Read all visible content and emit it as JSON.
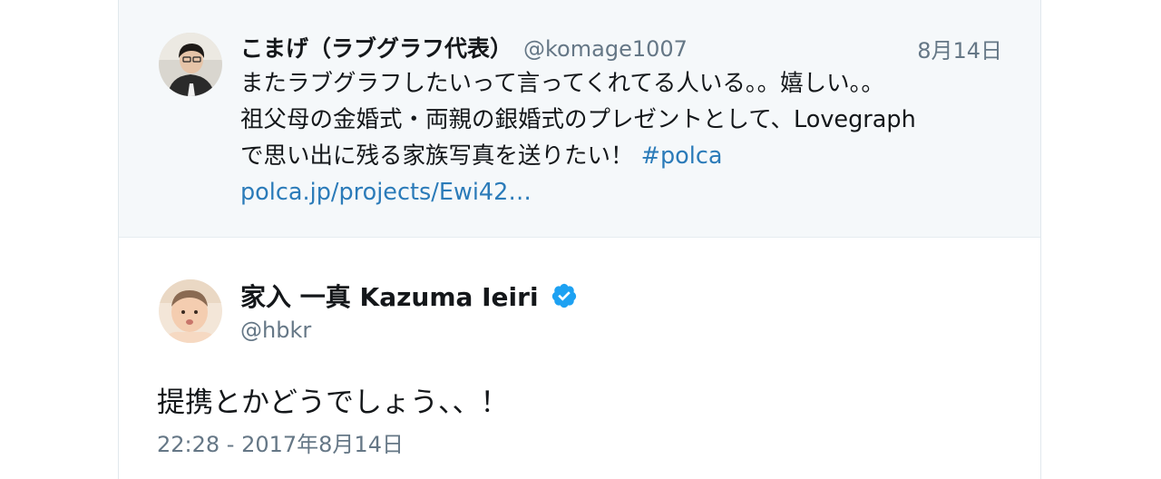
{
  "quoted_tweet": {
    "display_name": "こまげ（ラブグラフ代表）",
    "handle": "@komage1007",
    "date": "8月14日",
    "line1": "またラブグラフしたいって言ってくれてる人いる。。嬉しい。。",
    "line2": "祖父母の金婚式・両親の銀婚式のプレゼントとして、Lovegraph",
    "line3_text": "で思い出に残る家族写真を送りたい！ ",
    "hashtag": "#polca",
    "link": "polca.jp/projects/Ewi42…"
  },
  "main_tweet": {
    "display_name": "家入 一真 Kazuma Ieiri",
    "handle": "@hbkr",
    "text": "提携とかどうでしょう、、！",
    "timestamp": "22:28 - 2017年8月14日",
    "verified": true
  },
  "icons": {
    "verified": "verified-badge-icon",
    "quoted_avatar": "user-avatar",
    "main_avatar": "user-avatar"
  },
  "colors": {
    "link": "#1b95e0",
    "verified": "#1da1f2",
    "secondary_text": "#657786",
    "quoted_background": "#f5f8fa"
  }
}
